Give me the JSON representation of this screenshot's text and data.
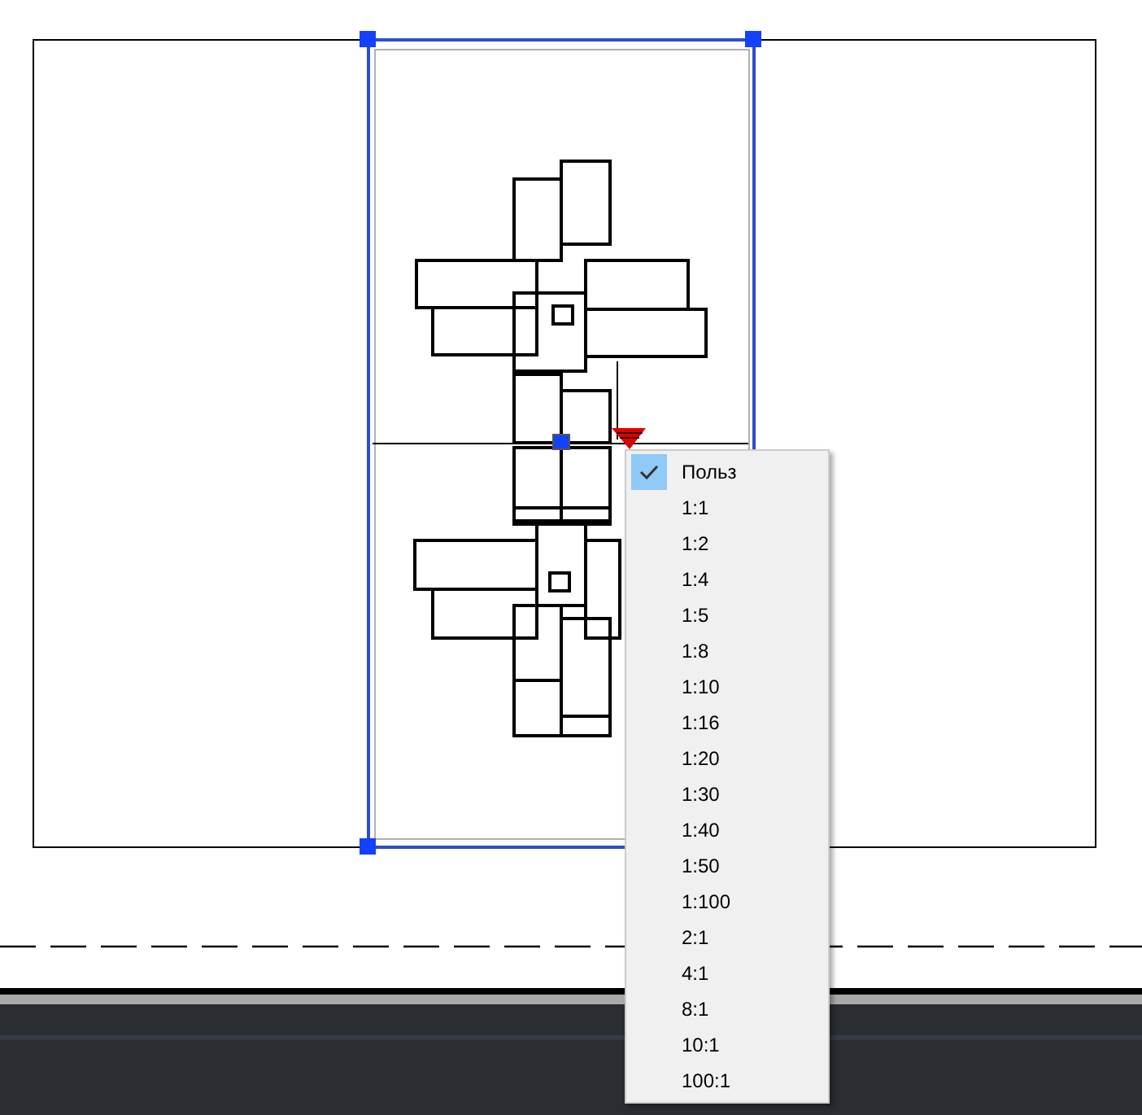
{
  "scale_menu": {
    "items": [
      {
        "label": "Польз",
        "selected": true
      },
      {
        "label": "1:1",
        "selected": false
      },
      {
        "label": "1:2",
        "selected": false
      },
      {
        "label": "1:4",
        "selected": false
      },
      {
        "label": "1:5",
        "selected": false
      },
      {
        "label": "1:8",
        "selected": false
      },
      {
        "label": "1:10",
        "selected": false
      },
      {
        "label": "1:16",
        "selected": false
      },
      {
        "label": "1:20",
        "selected": false
      },
      {
        "label": "1:30",
        "selected": false
      },
      {
        "label": "1:40",
        "selected": false
      },
      {
        "label": "1:50",
        "selected": false
      },
      {
        "label": "1:100",
        "selected": false
      },
      {
        "label": "2:1",
        "selected": false
      },
      {
        "label": "4:1",
        "selected": false
      },
      {
        "label": "8:1",
        "selected": false
      },
      {
        "label": "10:1",
        "selected": false
      },
      {
        "label": "100:1",
        "selected": false
      }
    ]
  }
}
